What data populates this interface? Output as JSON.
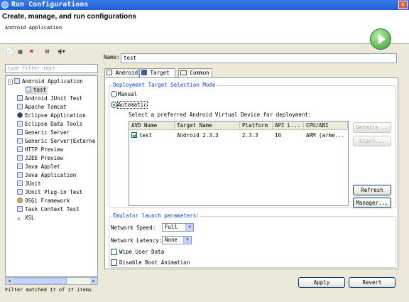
{
  "window": {
    "title": "Run Configurations",
    "close": "✕"
  },
  "header": {
    "title": "Create, manage, and run configurations",
    "subtitle": "Android Application"
  },
  "left": {
    "filter_placeholder": "type filter text",
    "tree": [
      {
        "label": "Android Application",
        "expanded": true
      },
      {
        "label": "test",
        "child": true,
        "selected": true
      },
      {
        "label": "Android JUnit Test"
      },
      {
        "label": "Apache Tomcat"
      },
      {
        "label": "Eclipse Application"
      },
      {
        "label": "Eclipse Data Tools"
      },
      {
        "label": "Generic Server"
      },
      {
        "label": "Generic Server(Externe"
      },
      {
        "label": "HTTP Preview"
      },
      {
        "label": "J2EE Preview"
      },
      {
        "label": "Java Applet"
      },
      {
        "label": "Java Application"
      },
      {
        "label": "JUnit"
      },
      {
        "label": "JUnit Plug-in Test"
      },
      {
        "label": "OSGi Framework"
      },
      {
        "label": "Task Context Test"
      },
      {
        "label": "XSL"
      }
    ],
    "status": "Filter matched 17 of 17 items"
  },
  "main": {
    "name_label": "Name:",
    "name_value": "test",
    "tabs": [
      "Android",
      "Target",
      "Common"
    ],
    "active_tab": "Target",
    "deploy": {
      "title": "Deployment Target Selection Mode",
      "manual": "Manual",
      "automatic": "Automatic",
      "selected": "Automatic",
      "prompt": "Select a preferred Android Virtual Device for deployment:",
      "columns": [
        "AVD Name",
        "Target Name",
        "Platform",
        "API L...",
        "CPU/ABI"
      ],
      "rows": [
        {
          "checked": true,
          "avd": "test",
          "target": "Android 2.3.3",
          "platform": "2.3.3",
          "api": "10",
          "cpu": "ARM (arme..."
        }
      ],
      "buttons": {
        "details": "Details...",
        "start": "Start...",
        "refresh": "Refresh",
        "manager": "Manager..."
      }
    },
    "emulator": {
      "title": "Emulator launch parameters:",
      "speed_label": "Network Speed:",
      "speed_value": "Full",
      "latency_label": "Network Latency:",
      "latency_value": "None",
      "wipe": "Wipe User Data",
      "boot": "Disable Boot Animation"
    },
    "apply": "Apply",
    "revert": "Revert"
  }
}
